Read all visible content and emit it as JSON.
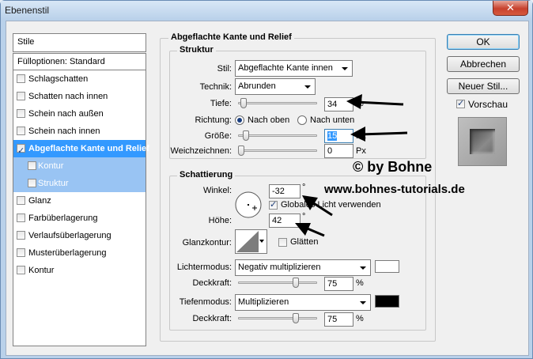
{
  "window": {
    "title": "Ebenenstil",
    "close_label": "✕"
  },
  "sidebar": {
    "header": "Stile",
    "fill_options": "Fülloptionen: Standard",
    "items": [
      {
        "label": "Schlagschatten",
        "checked": false
      },
      {
        "label": "Schatten nach innen",
        "checked": false
      },
      {
        "label": "Schein nach außen",
        "checked": false
      },
      {
        "label": "Schein nach innen",
        "checked": false
      },
      {
        "label": "Abgeflachte Kante und Relief",
        "checked": true
      },
      {
        "label": "Kontur",
        "checked": false
      },
      {
        "label": "Struktur",
        "checked": false
      },
      {
        "label": "Glanz",
        "checked": false
      },
      {
        "label": "Farbüberlagerung",
        "checked": false
      },
      {
        "label": "Verlaufsüberlagerung",
        "checked": false
      },
      {
        "label": "Musterüberlagerung",
        "checked": false
      },
      {
        "label": "Kontur",
        "checked": false
      }
    ]
  },
  "main": {
    "section_title": "Abgeflachte Kante und Relief",
    "structure": {
      "title": "Struktur",
      "style_label": "Stil:",
      "style_value": "Abgeflachte Kante innen",
      "technique_label": "Technik:",
      "technique_value": "Abrunden",
      "depth_label": "Tiefe:",
      "depth_value": "34",
      "depth_unit": "%",
      "depth_slider": 0.03,
      "direction_label": "Richtung:",
      "direction_up": "Nach oben",
      "direction_down": "Nach unten",
      "size_label": "Größe:",
      "size_value": "15",
      "size_unit": "Px",
      "size_slider": 0.06,
      "soften_label": "Weichzeichnen:",
      "soften_value": "0",
      "soften_unit": "Px",
      "soften_slider": 0.0
    },
    "shading": {
      "title": "Schattierung",
      "angle_label": "Winkel:",
      "angle_value": "-32",
      "angle_unit": "°",
      "global_light_label": "Globales Licht verwenden",
      "altitude_label": "Höhe:",
      "altitude_value": "42",
      "altitude_unit": "°",
      "gloss_label": "Glanzkontur:",
      "smooth_label": "Glätten",
      "highlight_mode_label": "Lichtermodus:",
      "highlight_mode_value": "Negativ multiplizieren",
      "highlight_color": "#ffffff",
      "highlight_opacity_label": "Deckkraft:",
      "highlight_opacity_value": "75",
      "highlight_opacity_unit": "%",
      "shadow_mode_label": "Tiefenmodus:",
      "shadow_mode_value": "Multiplizieren",
      "shadow_color": "#000000",
      "shadow_opacity_label": "Deckkraft:",
      "shadow_opacity_value": "75",
      "shadow_opacity_unit": "%"
    }
  },
  "buttons": {
    "ok": "OK",
    "cancel": "Abbrechen",
    "new_style": "Neuer Stil...",
    "preview_label": "Vorschau"
  },
  "watermark": {
    "line1": "© by Bohne",
    "line2": "www.bohnes-tutorials.de"
  }
}
